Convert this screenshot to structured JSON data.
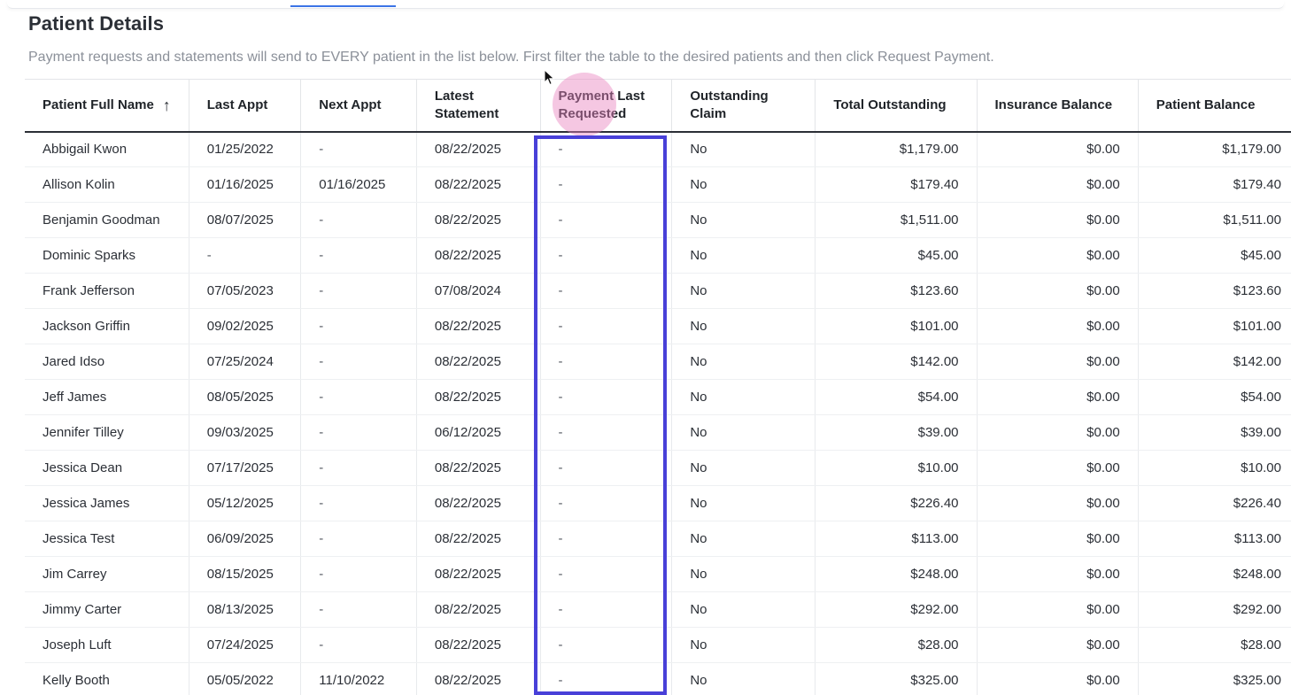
{
  "header": {
    "title": "Patient Details",
    "subtitle": "Payment requests and statements will send to EVERY patient in the list below. First filter the table to the desired patients and then click Request Payment."
  },
  "table": {
    "columns": [
      {
        "label": "Patient Full Name",
        "sorted": "ascending"
      },
      {
        "label": "Last Appt"
      },
      {
        "label": "Next Appt"
      },
      {
        "label": "Latest Statement"
      },
      {
        "label": "Payment Last Requested"
      },
      {
        "label": "Outstanding Claim"
      },
      {
        "label": "Total Outstanding"
      },
      {
        "label": "Insurance Balance"
      },
      {
        "label": "Patient Balance"
      }
    ],
    "rows": [
      {
        "name": "Abbigail Kwon",
        "last_appt": "01/25/2022",
        "next_appt": "-",
        "latest_statement": "08/22/2025",
        "payment_last_requested": "-",
        "outstanding_claim": "No",
        "total_outstanding": "$1,179.00",
        "insurance_balance": "$0.00",
        "patient_balance": "$1,179.00"
      },
      {
        "name": "Allison Kolin",
        "last_appt": "01/16/2025",
        "next_appt": "01/16/2025",
        "latest_statement": "08/22/2025",
        "payment_last_requested": "-",
        "outstanding_claim": "No",
        "total_outstanding": "$179.40",
        "insurance_balance": "$0.00",
        "patient_balance": "$179.40"
      },
      {
        "name": "Benjamin Goodman",
        "last_appt": "08/07/2025",
        "next_appt": "-",
        "latest_statement": "08/22/2025",
        "payment_last_requested": "-",
        "outstanding_claim": "No",
        "total_outstanding": "$1,511.00",
        "insurance_balance": "$0.00",
        "patient_balance": "$1,511.00"
      },
      {
        "name": "Dominic Sparks",
        "last_appt": "-",
        "next_appt": "-",
        "latest_statement": "08/22/2025",
        "payment_last_requested": "-",
        "outstanding_claim": "No",
        "total_outstanding": "$45.00",
        "insurance_balance": "$0.00",
        "patient_balance": "$45.00"
      },
      {
        "name": "Frank Jefferson",
        "last_appt": "07/05/2023",
        "next_appt": "-",
        "latest_statement": "07/08/2024",
        "payment_last_requested": "-",
        "outstanding_claim": "No",
        "total_outstanding": "$123.60",
        "insurance_balance": "$0.00",
        "patient_balance": "$123.60"
      },
      {
        "name": "Jackson Griffin",
        "last_appt": "09/02/2025",
        "next_appt": "-",
        "latest_statement": "08/22/2025",
        "payment_last_requested": "-",
        "outstanding_claim": "No",
        "total_outstanding": "$101.00",
        "insurance_balance": "$0.00",
        "patient_balance": "$101.00"
      },
      {
        "name": "Jared Idso",
        "last_appt": "07/25/2024",
        "next_appt": "-",
        "latest_statement": "08/22/2025",
        "payment_last_requested": "-",
        "outstanding_claim": "No",
        "total_outstanding": "$142.00",
        "insurance_balance": "$0.00",
        "patient_balance": "$142.00"
      },
      {
        "name": "Jeff James",
        "last_appt": "08/05/2025",
        "next_appt": "-",
        "latest_statement": "08/22/2025",
        "payment_last_requested": "-",
        "outstanding_claim": "No",
        "total_outstanding": "$54.00",
        "insurance_balance": "$0.00",
        "patient_balance": "$54.00"
      },
      {
        "name": "Jennifer Tilley",
        "last_appt": "09/03/2025",
        "next_appt": "-",
        "latest_statement": "06/12/2025",
        "payment_last_requested": "-",
        "outstanding_claim": "No",
        "total_outstanding": "$39.00",
        "insurance_balance": "$0.00",
        "patient_balance": "$39.00"
      },
      {
        "name": "Jessica Dean",
        "last_appt": "07/17/2025",
        "next_appt": "-",
        "latest_statement": "08/22/2025",
        "payment_last_requested": "-",
        "outstanding_claim": "No",
        "total_outstanding": "$10.00",
        "insurance_balance": "$0.00",
        "patient_balance": "$10.00"
      },
      {
        "name": "Jessica James",
        "last_appt": "05/12/2025",
        "next_appt": "-",
        "latest_statement": "08/22/2025",
        "payment_last_requested": "-",
        "outstanding_claim": "No",
        "total_outstanding": "$226.40",
        "insurance_balance": "$0.00",
        "patient_balance": "$226.40"
      },
      {
        "name": "Jessica Test",
        "last_appt": "06/09/2025",
        "next_appt": "-",
        "latest_statement": "08/22/2025",
        "payment_last_requested": "-",
        "outstanding_claim": "No",
        "total_outstanding": "$113.00",
        "insurance_balance": "$0.00",
        "patient_balance": "$113.00"
      },
      {
        "name": "Jim Carrey",
        "last_appt": "08/15/2025",
        "next_appt": "-",
        "latest_statement": "08/22/2025",
        "payment_last_requested": "-",
        "outstanding_claim": "No",
        "total_outstanding": "$248.00",
        "insurance_balance": "$0.00",
        "patient_balance": "$248.00"
      },
      {
        "name": "Jimmy Carter",
        "last_appt": "08/13/2025",
        "next_appt": "-",
        "latest_statement": "08/22/2025",
        "payment_last_requested": "-",
        "outstanding_claim": "No",
        "total_outstanding": "$292.00",
        "insurance_balance": "$0.00",
        "patient_balance": "$292.00"
      },
      {
        "name": "Joseph Luft",
        "last_appt": "07/24/2025",
        "next_appt": "-",
        "latest_statement": "08/22/2025",
        "payment_last_requested": "-",
        "outstanding_claim": "No",
        "total_outstanding": "$28.00",
        "insurance_balance": "$0.00",
        "patient_balance": "$28.00"
      },
      {
        "name": "Kelly Booth",
        "last_appt": "05/05/2022",
        "next_appt": "11/10/2022",
        "latest_statement": "08/22/2025",
        "payment_last_requested": "-",
        "outstanding_claim": "No",
        "total_outstanding": "$325.00",
        "insurance_balance": "$0.00",
        "patient_balance": "$325.00"
      }
    ]
  },
  "icons": {
    "sort": "arrow-up-icon",
    "cursor": "mouse-pointer-icon"
  },
  "colors": {
    "highlight_border": "#4840d8",
    "click_marker": "#e882be",
    "active_tab": "#3b74e6"
  }
}
